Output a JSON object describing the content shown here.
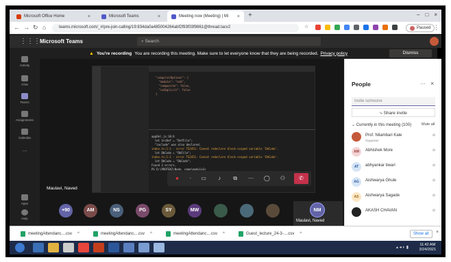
{
  "browser": {
    "tabs": [
      {
        "title": "Microsoft Office Home",
        "icon": "office-icon"
      },
      {
        "title": "Microsoft Teams",
        "icon": "teams-icon"
      },
      {
        "title": "Meeting now (Meeting) | Mi",
        "icon": "teams-icon"
      }
    ],
    "url": "teams.microsoft.com/_#/pre-join-calling/19:834da0a485004264abf2f93f03f9861@thread.tacv2",
    "profile_label": "Paused"
  },
  "teams": {
    "app_title": "Microsoft Teams",
    "search_placeholder": "Search",
    "rail": [
      {
        "label": "Activity"
      },
      {
        "label": "Chat"
      },
      {
        "label": "Teams"
      },
      {
        "label": "Assignments"
      },
      {
        "label": "Calendar"
      },
      {
        "label": "..."
      },
      {
        "label": "Apps"
      },
      {
        "label": "Help"
      }
    ]
  },
  "banner": {
    "bold": "You're recording",
    "text": "You are recording this meeting. Make sure to let everyone know that they are being recorded.",
    "link": "Privacy policy",
    "dismiss": "Dismiss"
  },
  "stage": {
    "presenter": "Maulavi, Naved",
    "code_lines": [
      "\"compilerOptions\": {",
      "  \"module\": \"es6\",",
      "  \"composite\": false,",
      "  \"noImplicit\": false",
      "}"
    ],
    "terminal_lines": [
      "appDel.js:10:6",
      "  let SrcDef = \"DefFile\";",
      "  \"include\" was also declared.",
      "index.ts:1:1 - error TS2451: Cannot redeclare block-scoped variable 'DbCode'.",
      "  let DbCode = \"DbFile\";",
      "index.ts:1:1 - error TS2451: Cannot redeclare block-scoped variable 'DbCode'.",
      "  let DbCode = \"DbCode\";",
      "Found 2 errors.",
      "PS D:\\PROTEK2\\Node. name\\module2>"
    ]
  },
  "participants_row": [
    "+90",
    "AM",
    "NS",
    "PG",
    "SY",
    "MW"
  ],
  "self_view": {
    "initials": "NM",
    "name": "Maulavi, Naved"
  },
  "people": {
    "title": "People",
    "invite_placeholder": "Invite someone",
    "share_invite": "Share invite",
    "currently": "Currently in this meeting (100)",
    "mute_all": "Mute all",
    "list": [
      {
        "initials": "",
        "name": "Prof. Nilambari Kale",
        "role": "Organiser",
        "color": "#c55a3a"
      },
      {
        "initials": "AM",
        "name": "Abhishek More",
        "role": "",
        "color": "#f4d4d4"
      },
      {
        "initials": "AT",
        "name": "abhyankar tiwari",
        "role": "",
        "color": "#d6e4f7"
      },
      {
        "initials": "AG",
        "name": "Aishwarya Ghule",
        "role": "",
        "color": "#d6e4f7"
      },
      {
        "initials": "AS",
        "name": "Aishwarya Sagade",
        "role": "",
        "color": "#fde7c4"
      },
      {
        "initials": "",
        "name": "AKASH CHAVAN",
        "role": "",
        "color": "#222222"
      }
    ]
  },
  "downloads": [
    "meetingAttendanc....csv",
    "meetingAttendanc....csv",
    "meetingAttendanc....csv",
    "Guest_lecture_24-3-....csv"
  ],
  "show_all": "Show all",
  "clock": {
    "time": "11:42 AM",
    "date": "3/24/2021"
  },
  "colors": {
    "teams_purple": "#6264a7",
    "hangup_red": "#c4314b",
    "recording_red": "#e33333"
  }
}
